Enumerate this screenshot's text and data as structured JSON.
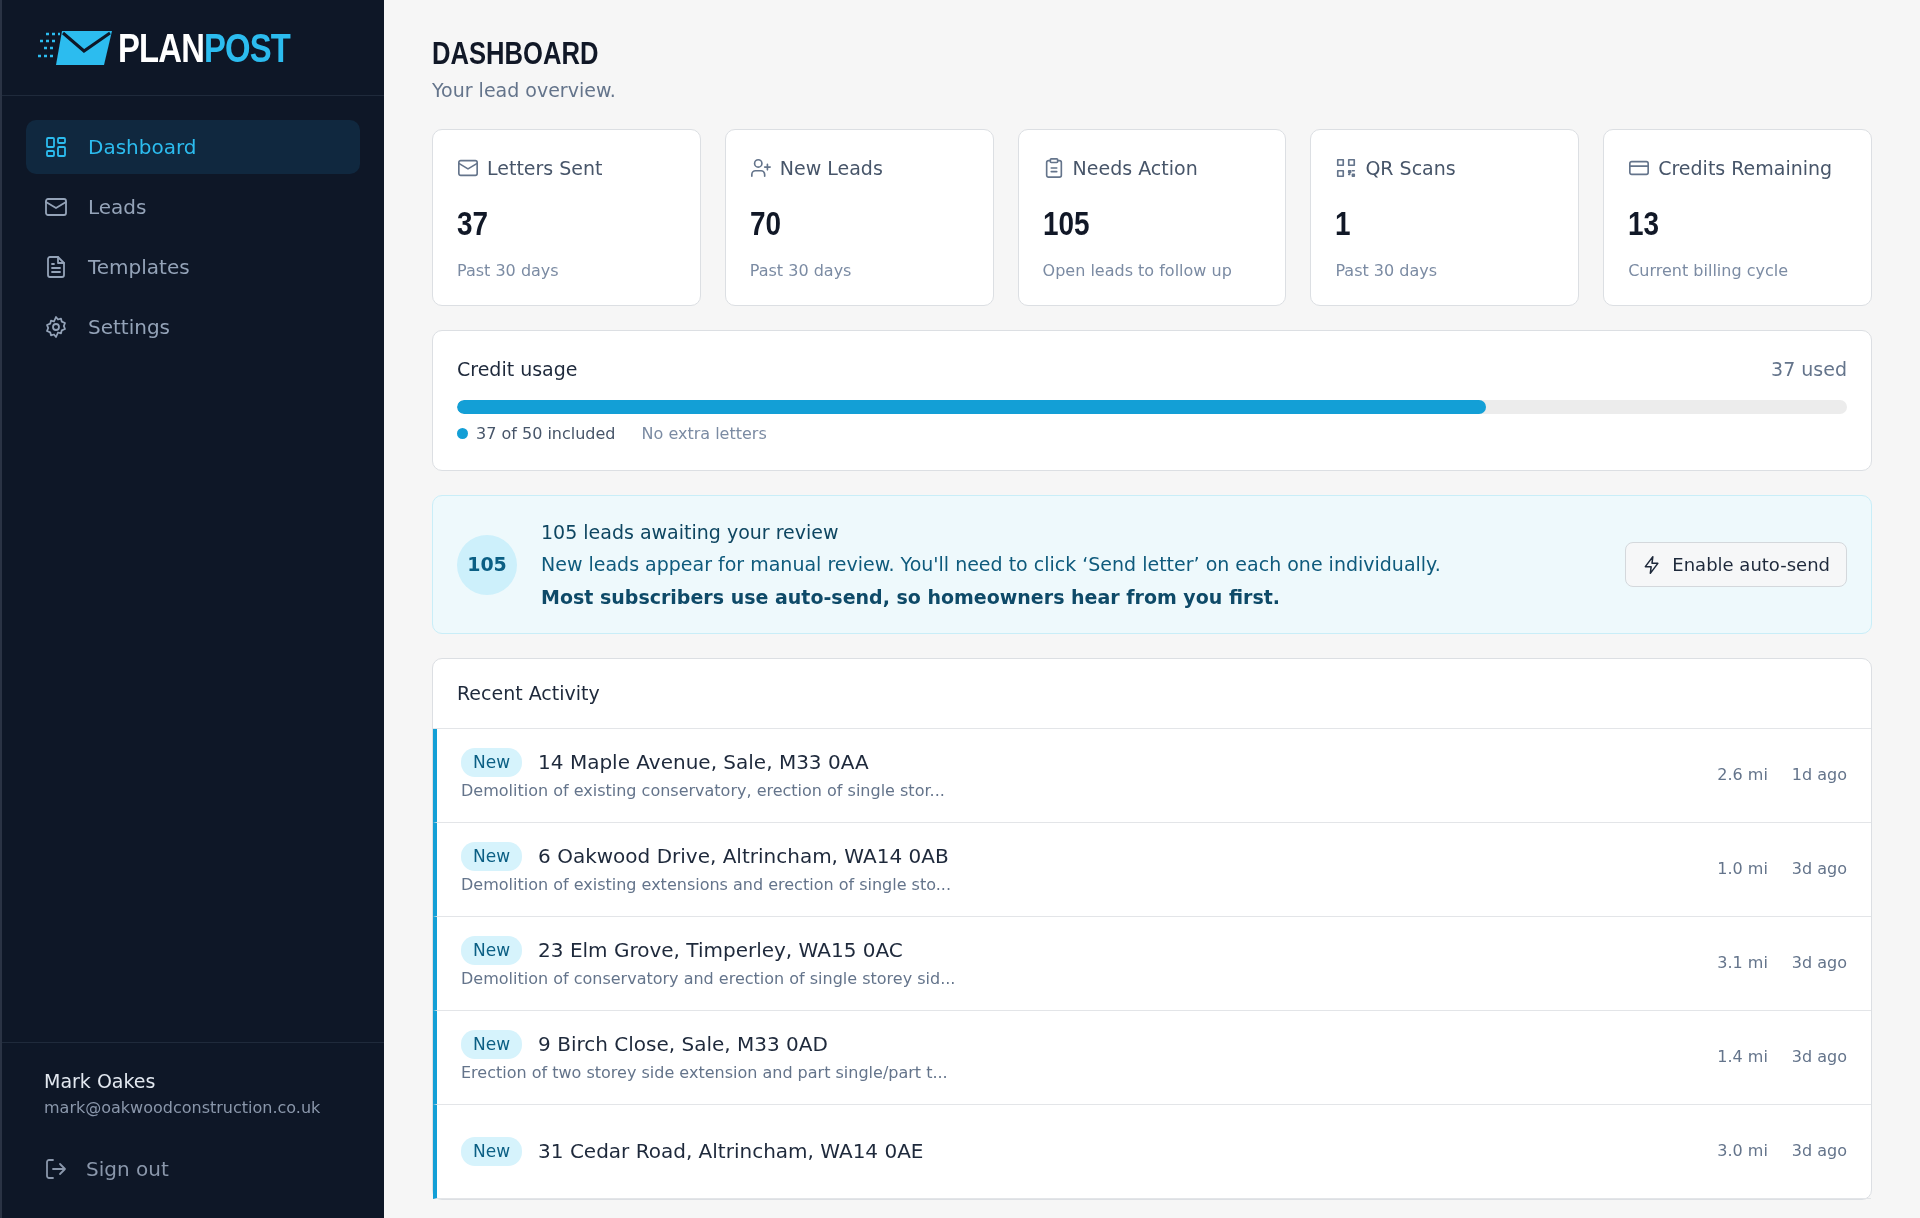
{
  "brand": {
    "part_1": "PLAN",
    "part_2": "POST"
  },
  "nav": [
    {
      "label": "Dashboard",
      "selected": true
    },
    {
      "label": "Leads",
      "selected": false
    },
    {
      "label": "Templates",
      "selected": false
    },
    {
      "label": "Settings",
      "selected": false
    }
  ],
  "user": {
    "name": "Mark Oakes",
    "email": "mark@oakwoodconstruction.co.uk",
    "sign_out": "Sign out"
  },
  "page": {
    "title": "DASHBOARD",
    "subtitle": "Your lead overview."
  },
  "stats": [
    {
      "label": "Letters Sent",
      "value": "37",
      "note": "Past 30 days"
    },
    {
      "label": "New Leads",
      "value": "70",
      "note": "Past 30 days"
    },
    {
      "label": "Needs Action",
      "value": "105",
      "note": "Open leads to follow up"
    },
    {
      "label": "QR Scans",
      "value": "1",
      "note": "Past 30 days"
    },
    {
      "label": "Credits Remaining",
      "value": "13",
      "note": "Current billing cycle"
    }
  ],
  "credit_usage": {
    "title": "Credit usage",
    "used": "37 used",
    "level": 0.74,
    "included": "37 of 50 included",
    "extra": "No extra letters"
  },
  "review_banner": {
    "count": "105",
    "title": "105 leads awaiting your review",
    "line_1": "New leads appear for manual review. You'll need to click ‘Send letter’ on each one individually.",
    "line_2": "Most subscribers use auto-send, so homeowners hear from you first.",
    "button": "Enable auto-send"
  },
  "recent_activity": {
    "title": "Recent Activity",
    "rows": [
      {
        "tag": "New",
        "address": "14 Maple Avenue, Sale, M33 0AA",
        "description": "Demolition of existing conservatory, erection of single stor...",
        "distance": "2.6 mi",
        "age": "1d ago"
      },
      {
        "tag": "New",
        "address": "6 Oakwood Drive, Altrincham, WA14 0AB",
        "description": "Demolition of existing extensions and erection of single sto...",
        "distance": "1.0 mi",
        "age": "3d ago"
      },
      {
        "tag": "New",
        "address": "23 Elm Grove, Timperley, WA15 0AC",
        "description": "Demolition of conservatory and erection of single storey sid...",
        "distance": "3.1 mi",
        "age": "3d ago"
      },
      {
        "tag": "New",
        "address": "9 Birch Close, Sale, M33 0AD",
        "description": "Erection of two storey side extension and part single/part t...",
        "distance": "1.4 mi",
        "age": "3d ago"
      },
      {
        "tag": "New",
        "address": "31 Cedar Road, Altrincham, WA14 0AE",
        "distance": "3.0 mi",
        "age": "3d ago"
      }
    ]
  }
}
